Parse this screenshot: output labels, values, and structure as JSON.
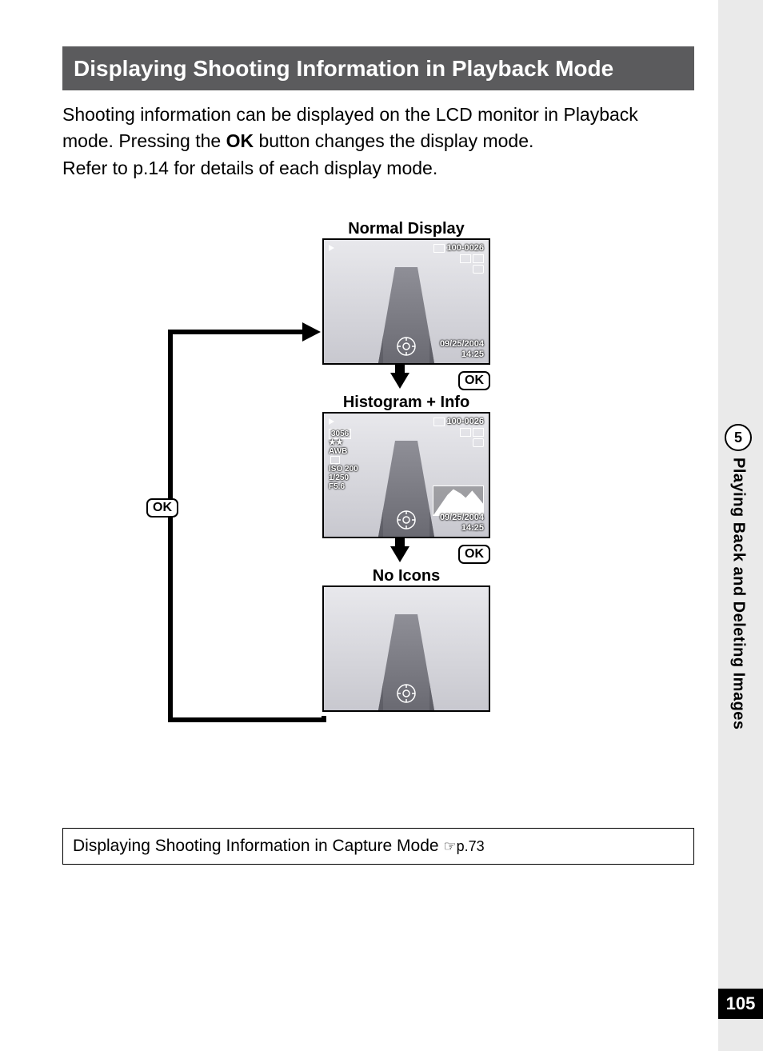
{
  "heading": "Displaying Shooting Information in Playback Mode",
  "body": {
    "line1a": "Shooting information can be displayed on the LCD monitor in Playback mode. Pressing the ",
    "ok": "OK",
    "line1b": " button changes the display mode.",
    "line2": "Refer to p.14 for details of each display mode."
  },
  "captions": {
    "normal": "Normal Display",
    "histogram": "Histogram + Info",
    "noicons": "No Icons"
  },
  "ok_button": "OK",
  "lcd_normal": {
    "folder": "100-0026",
    "date": "09/25/2004",
    "time": "14:25"
  },
  "lcd_hist": {
    "folder": "100-0026",
    "remaining": "3056",
    "quality": "★★",
    "awb": "AWB",
    "iso": "ISO 200",
    "shutter": "1/250",
    "aperture": "F5.6",
    "date": "09/25/2004",
    "time": "14:25"
  },
  "crossref": {
    "text": "Displaying Shooting Information in Capture Mode ",
    "ref": "☞p.73"
  },
  "tab": {
    "number": "5",
    "label": "Playing Back and Deleting Images"
  },
  "page_number": "105"
}
